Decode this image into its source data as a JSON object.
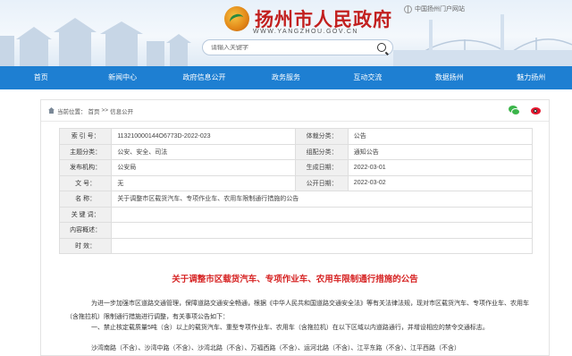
{
  "header": {
    "site_title": "扬州市人民政府",
    "site_url": "WWW.YANGZHOU.GOV.CN",
    "portal_link": "中国扬州门户网站",
    "search_placeholder": "请输入关键字"
  },
  "nav": {
    "items": [
      "首页",
      "新闻中心",
      "政府信息公开",
      "政务服务",
      "互动交流",
      "数据扬州",
      "魅力扬州"
    ]
  },
  "breadcrumb": {
    "prefix": "当前位置：",
    "items": [
      "首页",
      "信息公开"
    ],
    "separator": ">>"
  },
  "info": {
    "index_label": "索 引 号：",
    "index_value": "113210000144O6773D-2022-023",
    "category_label": "体裁分类：",
    "category_value": "公告",
    "topic_label": "主题分类：",
    "topic_value": "公安、安全、司法",
    "org_type_label": "组配分类：",
    "org_type_value": "通知公告",
    "issuer_label": "发布机构：",
    "issuer_value": "公安局",
    "created_label": "生成日期：",
    "created_value": "2022-03-01",
    "docno_label": "文 号：",
    "docno_value": "无",
    "published_label": "公开日期：",
    "published_value": "2022-03-02",
    "name_label": "名 称：",
    "name_value": "关于调整市区载货汽车、专项作业车、农用车限制通行措施的公告",
    "keywords_label": "关 键 词：",
    "keywords_value": "",
    "summary_label": "内容概述：",
    "summary_value": "",
    "validity_label": "时 效：",
    "validity_value": ""
  },
  "article": {
    "title": "关于调整市区载货汽车、专项作业车、农用车限制通行措施的公告",
    "body": "为进一步加强市区道路交通管理，保障道路交通安全畅通，根据《中华人民共和国道路交通安全法》等有关法律法规，现对市区载货汽车、专项作业车、农用车（含拖拉机）限制通行措施进行调整，有关事项公告如下：",
    "sub": "一、禁止核定载质量5吨（含）以上的载货汽车、重型专项作业车、农用车（含拖拉机）在以下区域以内道路通行，并增设相应的禁令交通标志。",
    "roads": "沙湾南路（不含）、沙湾中路（不含）、沙湾北路（不含）、万福西路（不含）、运河北路（不含）、江平东路（不含）、江平西路（不含）"
  }
}
